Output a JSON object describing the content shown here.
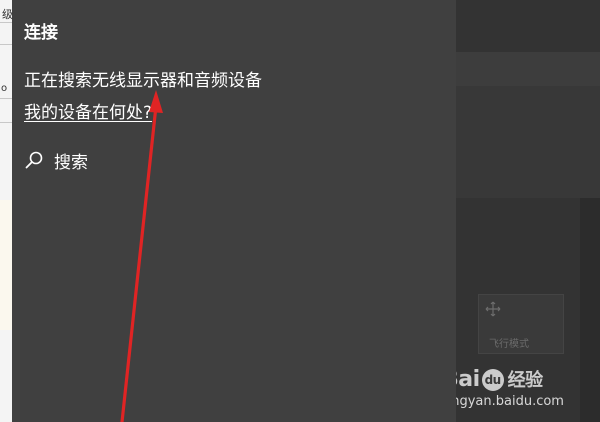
{
  "left_window": {
    "cut_text_1": "级",
    "cut_text_2": "o"
  },
  "connect_panel": {
    "title": "连接",
    "status": "正在搜索无线显示器和音频设备",
    "help_link": "我的设备在何处?",
    "search_label": "搜索"
  },
  "action_center": {
    "airplane_tile_label": "飞行模式"
  },
  "watermark": {
    "brand_prefix": "Bai",
    "paw": "du",
    "brand_cn": "经验",
    "url": "jingyan.baidu.com"
  },
  "colors": {
    "panel_bg": "#404040",
    "text": "#ffffff",
    "annotation_arrow": "#e02424"
  },
  "icons": {
    "search": "search-icon",
    "airplane_tile": "airplane-icon"
  }
}
